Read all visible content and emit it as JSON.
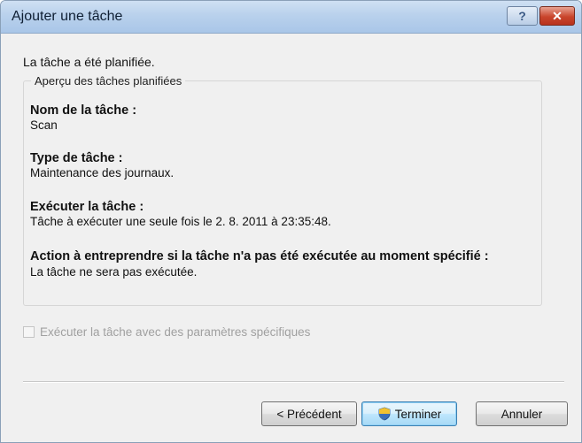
{
  "window": {
    "title": "Ajouter une tâche",
    "help_label": "?",
    "close_label": "✕"
  },
  "status_text": "La tâche a été planifiée.",
  "group": {
    "legend": "Aperçu des tâches planifiées",
    "sections": [
      {
        "label": "Nom de la tâche :",
        "value": "Scan"
      },
      {
        "label": "Type de tâche :",
        "value": "Maintenance des journaux."
      },
      {
        "label": "Exécuter la tâche :",
        "value": "Tâche à exécuter une seule fois le 2. 8. 2011 à 23:35:48."
      },
      {
        "label": "Action à entreprendre si la tâche n'a pas été exécutée au moment spécifié :",
        "value": "La tâche ne sera pas exécutée."
      }
    ]
  },
  "checkbox": {
    "label": "Exécuter la tâche avec des paramètres spécifiques",
    "checked": false,
    "enabled": false
  },
  "buttons": {
    "previous": "< Précédent",
    "finish": "Terminer",
    "cancel": "Annuler"
  },
  "icons": {
    "finish_icon": "uac-shield-icon"
  },
  "colors": {
    "titlebar": "#b9d1ec",
    "close_button": "#c9452c",
    "dialog_background": "#f0f0f0",
    "default_button_border": "#3c7fb1"
  }
}
